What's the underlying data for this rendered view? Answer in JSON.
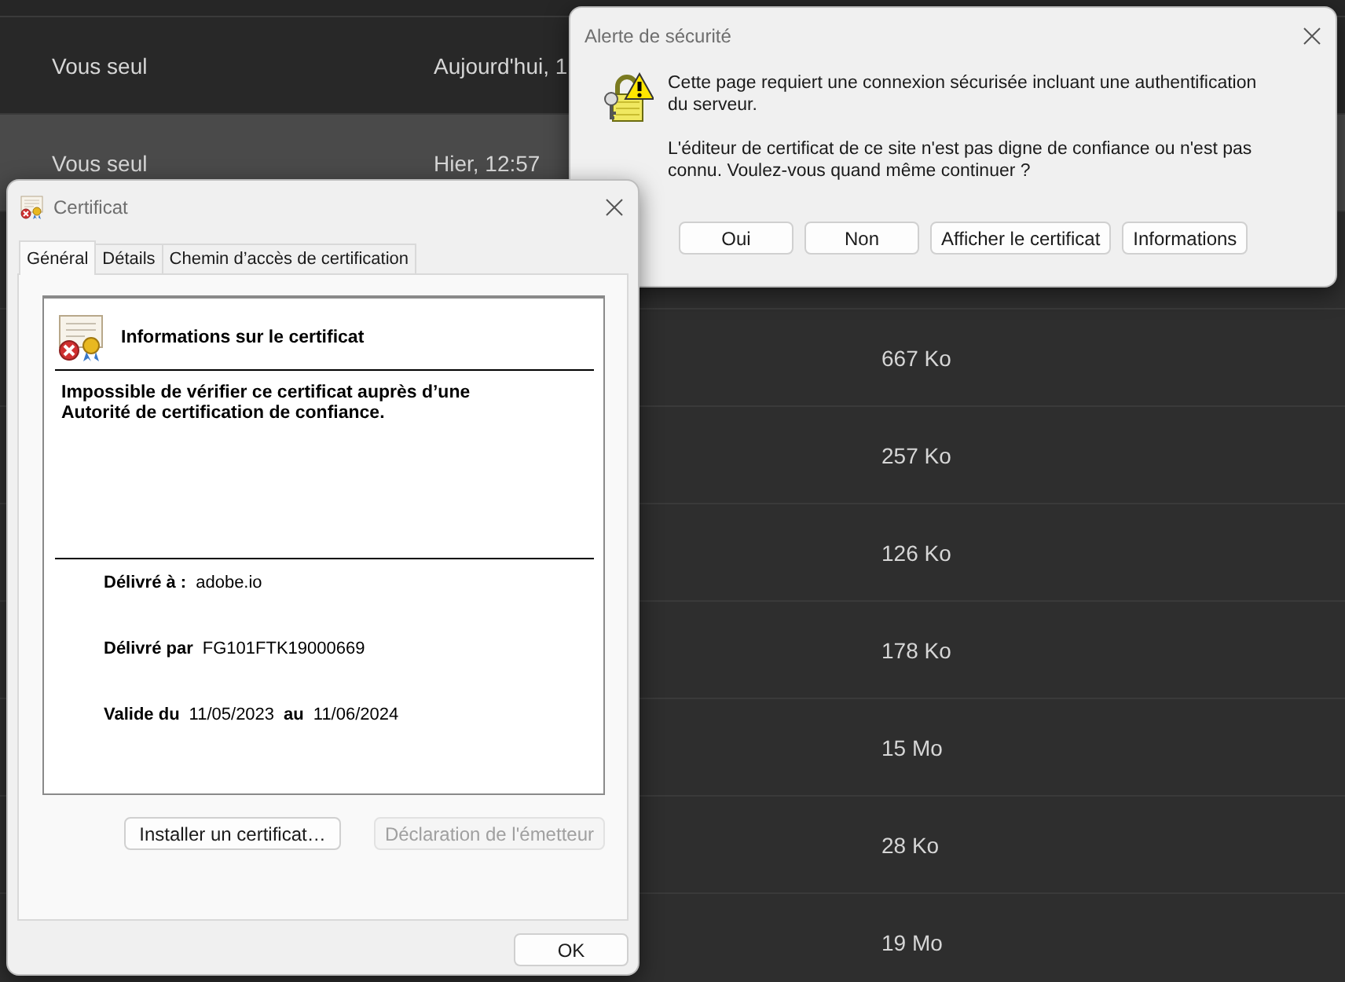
{
  "file_list": {
    "rows": [
      {
        "owner": "Vous seul",
        "date": "Aujourd'hui, 1",
        "selected": false
      },
      {
        "owner": "Vous seul",
        "date": "Hier, 12:57",
        "selected": true
      },
      {
        "selected": false
      },
      {
        "size": "667 Ko",
        "selected": false
      },
      {
        "size": "257 Ko",
        "selected": false
      },
      {
        "size": "126 Ko",
        "selected": false
      },
      {
        "size": "178 Ko",
        "selected": false
      },
      {
        "size": "15 Mo",
        "selected": false
      },
      {
        "size": "28 Ko",
        "selected": false
      },
      {
        "size": "19 Mo",
        "selected": false
      }
    ]
  },
  "security_alert": {
    "title": "Alerte de sécurité",
    "messages": [
      "Cette page requiert une connexion sécurisée incluant une authentification du serveur.",
      "L'éditeur de certificat de ce site n'est pas digne de confiance ou n'est pas connu. Voulez-vous quand même continuer ?"
    ],
    "buttons": [
      "Oui",
      "Non",
      "Afficher le certificat",
      "Informations"
    ]
  },
  "certificate": {
    "title": "Certificat",
    "tabs": [
      {
        "label": "Général",
        "selected": true
      },
      {
        "label": "Détails",
        "selected": false
      },
      {
        "label": "Chemin d’accès de certification",
        "selected": false
      }
    ],
    "heading": "Informations sur le certificat",
    "status_message": "Impossible de vérifier ce certificat auprès d’une Autorité de certification de confiance.",
    "fields": [
      {
        "label": "Délivré à :",
        "value": "adobe.io"
      },
      {
        "label": "Délivré par",
        "value": "FG101FTK19000669"
      }
    ],
    "validity": {
      "from_label": "Valide du",
      "from": "11/05/2023",
      "to_label": "au",
      "to": "11/06/2024"
    },
    "buttons": [
      {
        "label": "Installer un certificat…",
        "disabled": false
      },
      {
        "label": "Déclaration de l'émetteur",
        "disabled": true
      }
    ],
    "ok_button": "OK"
  }
}
